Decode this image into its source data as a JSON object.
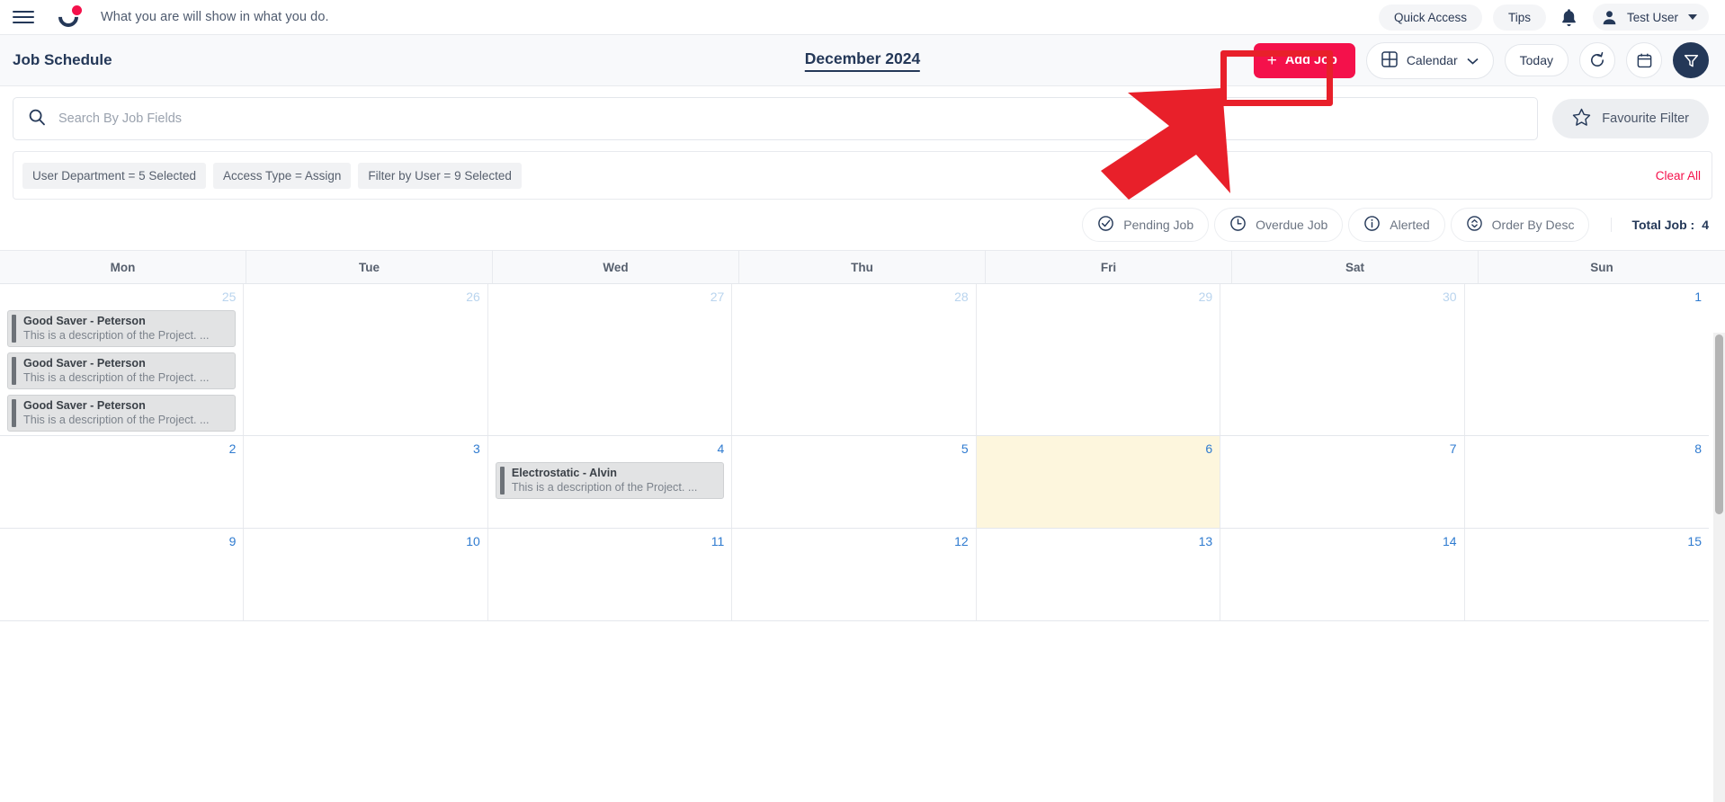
{
  "topnav": {
    "menu_icon": "hamburger-icon",
    "logo_icon": "brand-logo-icon",
    "tagline": "What you are will show in what you do.",
    "quick_access": "Quick Access",
    "tips": "Tips",
    "bell_icon": "notification-bell-icon",
    "user_name": "Test User"
  },
  "header": {
    "title": "Job Schedule",
    "month": "December 2024",
    "add_job": "Add Job",
    "view_mode": "Calendar",
    "today": "Today",
    "refresh_icon": "refresh-icon",
    "date_picker_icon": "calendar-icon",
    "filter_icon": "filter-funnel-icon"
  },
  "search": {
    "placeholder": "Search By Job Fields",
    "value": "",
    "icon": "search-icon",
    "favourite_filter": "Favourite Filter",
    "star_icon": "star-icon"
  },
  "filters": {
    "chips": [
      "User Department  =  5 Selected",
      "Access Type  =  Assign",
      "Filter by User  =  9 Selected"
    ],
    "clear_all": "Clear All"
  },
  "status": {
    "items": [
      {
        "label": "Pending Job",
        "icon": "check-circle-icon"
      },
      {
        "label": "Overdue Job",
        "icon": "clock-icon"
      },
      {
        "label": "Alerted",
        "icon": "info-circle-icon"
      },
      {
        "label": "Order By Desc",
        "icon": "sort-updown-icon"
      }
    ],
    "total_label": "Total Job :",
    "total_value": "4"
  },
  "calendar": {
    "weekdays": [
      "Mon",
      "Tue",
      "Wed",
      "Thu",
      "Fri",
      "Sat",
      "Sun"
    ],
    "weeks": [
      [
        {
          "day": "25",
          "other_month": true,
          "today": false,
          "events": [
            {
              "title": "Good Saver - Peterson",
              "desc": "This is a description of the Project. ..."
            },
            {
              "title": "Good Saver - Peterson",
              "desc": "This is a description of the Project. ..."
            },
            {
              "title": "Good Saver - Peterson",
              "desc": "This is a description of the Project. ..."
            }
          ]
        },
        {
          "day": "26",
          "other_month": true,
          "today": false,
          "events": []
        },
        {
          "day": "27",
          "other_month": true,
          "today": false,
          "events": []
        },
        {
          "day": "28",
          "other_month": true,
          "today": false,
          "events": []
        },
        {
          "day": "29",
          "other_month": true,
          "today": false,
          "events": []
        },
        {
          "day": "30",
          "other_month": true,
          "today": false,
          "events": []
        },
        {
          "day": "1",
          "other_month": false,
          "today": false,
          "events": []
        }
      ],
      [
        {
          "day": "2",
          "other_month": false,
          "today": false,
          "events": []
        },
        {
          "day": "3",
          "other_month": false,
          "today": false,
          "events": []
        },
        {
          "day": "4",
          "other_month": false,
          "today": false,
          "events": [
            {
              "title": "Electrostatic - Alvin",
              "desc": "This is a description of the Project. ..."
            }
          ]
        },
        {
          "day": "5",
          "other_month": false,
          "today": false,
          "events": []
        },
        {
          "day": "6",
          "other_month": false,
          "today": true,
          "events": []
        },
        {
          "day": "7",
          "other_month": false,
          "today": false,
          "events": []
        },
        {
          "day": "8",
          "other_month": false,
          "today": false,
          "events": []
        }
      ],
      [
        {
          "day": "9",
          "other_month": false,
          "today": false,
          "events": []
        },
        {
          "day": "10",
          "other_month": false,
          "today": false,
          "events": []
        },
        {
          "day": "11",
          "other_month": false,
          "today": false,
          "events": []
        },
        {
          "day": "12",
          "other_month": false,
          "today": false,
          "events": []
        },
        {
          "day": "13",
          "other_month": false,
          "today": false,
          "events": []
        },
        {
          "day": "14",
          "other_month": false,
          "today": false,
          "events": []
        },
        {
          "day": "15",
          "other_month": false,
          "today": false,
          "events": []
        }
      ]
    ]
  },
  "colors": {
    "accent": "#f4114b",
    "navy": "#243858",
    "today_bg": "#fdf6dd",
    "day_number": "#2f7bd0",
    "annotation": "#e8202a"
  },
  "annotation": {
    "highlight_target": "Add Job",
    "shape": "arrow-pointing-to-add-job-button"
  }
}
